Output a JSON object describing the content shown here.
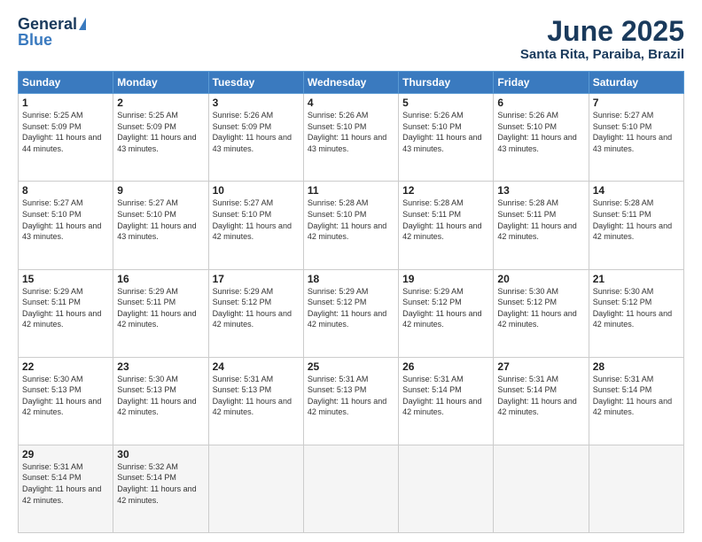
{
  "logo": {
    "general": "General",
    "blue": "Blue"
  },
  "title": {
    "month": "June 2025",
    "location": "Santa Rita, Paraiba, Brazil"
  },
  "headers": [
    "Sunday",
    "Monday",
    "Tuesday",
    "Wednesday",
    "Thursday",
    "Friday",
    "Saturday"
  ],
  "weeks": [
    [
      {
        "day": "1",
        "rise": "5:25 AM",
        "set": "5:09 PM",
        "daylight": "11 hours and 44 minutes."
      },
      {
        "day": "2",
        "rise": "5:25 AM",
        "set": "5:09 PM",
        "daylight": "11 hours and 43 minutes."
      },
      {
        "day": "3",
        "rise": "5:26 AM",
        "set": "5:09 PM",
        "daylight": "11 hours and 43 minutes."
      },
      {
        "day": "4",
        "rise": "5:26 AM",
        "set": "5:10 PM",
        "daylight": "11 hours and 43 minutes."
      },
      {
        "day": "5",
        "rise": "5:26 AM",
        "set": "5:10 PM",
        "daylight": "11 hours and 43 minutes."
      },
      {
        "day": "6",
        "rise": "5:26 AM",
        "set": "5:10 PM",
        "daylight": "11 hours and 43 minutes."
      },
      {
        "day": "7",
        "rise": "5:27 AM",
        "set": "5:10 PM",
        "daylight": "11 hours and 43 minutes."
      }
    ],
    [
      {
        "day": "8",
        "rise": "5:27 AM",
        "set": "5:10 PM",
        "daylight": "11 hours and 43 minutes."
      },
      {
        "day": "9",
        "rise": "5:27 AM",
        "set": "5:10 PM",
        "daylight": "11 hours and 43 minutes."
      },
      {
        "day": "10",
        "rise": "5:27 AM",
        "set": "5:10 PM",
        "daylight": "11 hours and 42 minutes."
      },
      {
        "day": "11",
        "rise": "5:28 AM",
        "set": "5:10 PM",
        "daylight": "11 hours and 42 minutes."
      },
      {
        "day": "12",
        "rise": "5:28 AM",
        "set": "5:11 PM",
        "daylight": "11 hours and 42 minutes."
      },
      {
        "day": "13",
        "rise": "5:28 AM",
        "set": "5:11 PM",
        "daylight": "11 hours and 42 minutes."
      },
      {
        "day": "14",
        "rise": "5:28 AM",
        "set": "5:11 PM",
        "daylight": "11 hours and 42 minutes."
      }
    ],
    [
      {
        "day": "15",
        "rise": "5:29 AM",
        "set": "5:11 PM",
        "daylight": "11 hours and 42 minutes."
      },
      {
        "day": "16",
        "rise": "5:29 AM",
        "set": "5:11 PM",
        "daylight": "11 hours and 42 minutes."
      },
      {
        "day": "17",
        "rise": "5:29 AM",
        "set": "5:12 PM",
        "daylight": "11 hours and 42 minutes."
      },
      {
        "day": "18",
        "rise": "5:29 AM",
        "set": "5:12 PM",
        "daylight": "11 hours and 42 minutes."
      },
      {
        "day": "19",
        "rise": "5:29 AM",
        "set": "5:12 PM",
        "daylight": "11 hours and 42 minutes."
      },
      {
        "day": "20",
        "rise": "5:30 AM",
        "set": "5:12 PM",
        "daylight": "11 hours and 42 minutes."
      },
      {
        "day": "21",
        "rise": "5:30 AM",
        "set": "5:12 PM",
        "daylight": "11 hours and 42 minutes."
      }
    ],
    [
      {
        "day": "22",
        "rise": "5:30 AM",
        "set": "5:13 PM",
        "daylight": "11 hours and 42 minutes."
      },
      {
        "day": "23",
        "rise": "5:30 AM",
        "set": "5:13 PM",
        "daylight": "11 hours and 42 minutes."
      },
      {
        "day": "24",
        "rise": "5:31 AM",
        "set": "5:13 PM",
        "daylight": "11 hours and 42 minutes."
      },
      {
        "day": "25",
        "rise": "5:31 AM",
        "set": "5:13 PM",
        "daylight": "11 hours and 42 minutes."
      },
      {
        "day": "26",
        "rise": "5:31 AM",
        "set": "5:14 PM",
        "daylight": "11 hours and 42 minutes."
      },
      {
        "day": "27",
        "rise": "5:31 AM",
        "set": "5:14 PM",
        "daylight": "11 hours and 42 minutes."
      },
      {
        "day": "28",
        "rise": "5:31 AM",
        "set": "5:14 PM",
        "daylight": "11 hours and 42 minutes."
      }
    ],
    [
      {
        "day": "29",
        "rise": "5:31 AM",
        "set": "5:14 PM",
        "daylight": "11 hours and 42 minutes."
      },
      {
        "day": "30",
        "rise": "5:32 AM",
        "set": "5:14 PM",
        "daylight": "11 hours and 42 minutes."
      },
      null,
      null,
      null,
      null,
      null
    ]
  ]
}
